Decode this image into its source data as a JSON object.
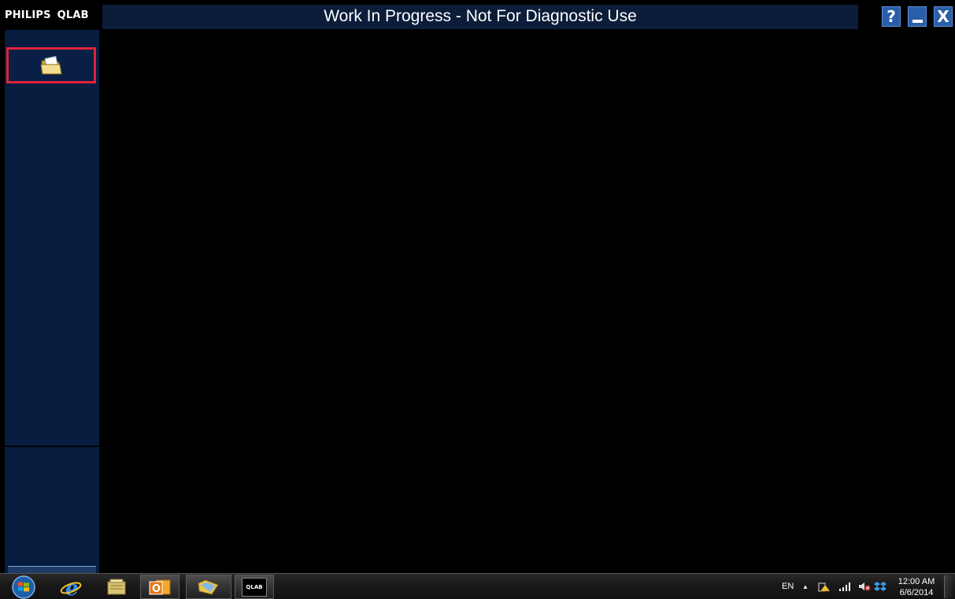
{
  "app": {
    "brand_left": "PHILIPS",
    "brand_right": "QLAB",
    "title": "Work In Progress - Not For Diagnostic Use"
  },
  "window_controls": {
    "help": "?",
    "close": "X"
  },
  "sidebar": {
    "open_button_icon": "open-folder-icon",
    "open_button_highlight_color": "#e0223a"
  },
  "taskbar": {
    "pinned": [
      "start-orb-icon",
      "internet-explorer-icon",
      "file-explorer-icon",
      "outlook-icon",
      "folder-app-icon",
      "qlab-icon"
    ],
    "qlab_label": "QLAB",
    "tray": {
      "language": "EN",
      "time": "12:00 AM",
      "date": "6/6/2014"
    }
  },
  "colors": {
    "sidebar_bg": "#071d3f",
    "title_strip_bg": "#0c1d3a",
    "window_button_bg": "#2a5ea8",
    "main_bg": "#000000"
  }
}
